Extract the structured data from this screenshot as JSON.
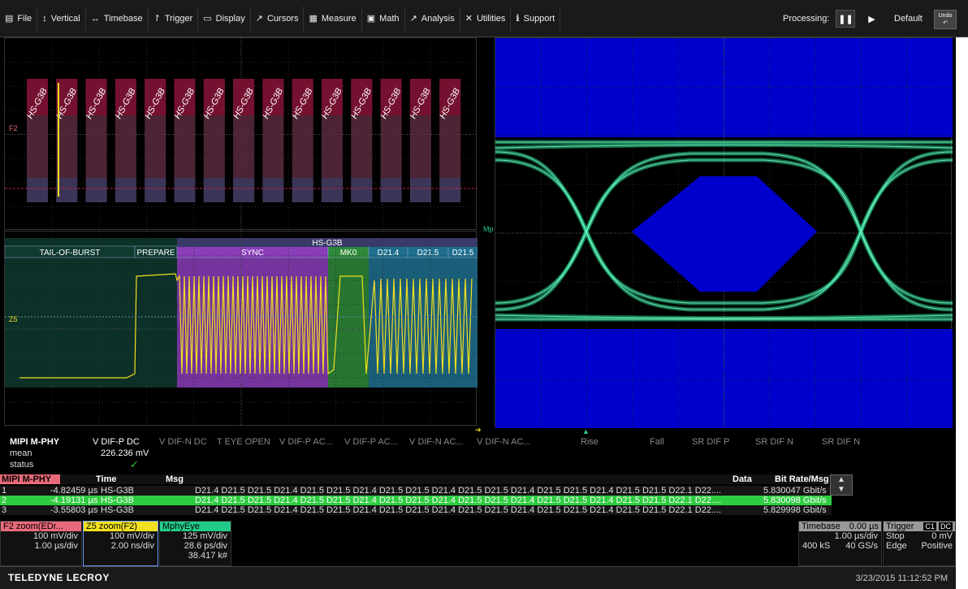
{
  "menu": [
    {
      "icon": "clipboard-icon",
      "glyph": "▤",
      "label": "File"
    },
    {
      "icon": "vertical-arrows-icon",
      "glyph": "↕",
      "label": "Vertical"
    },
    {
      "icon": "horizontal-arrows-icon",
      "glyph": "↔",
      "label": "Timebase"
    },
    {
      "icon": "trigger-flag-icon",
      "glyph": "↾",
      "label": "Trigger"
    },
    {
      "icon": "display-icon",
      "glyph": "▭",
      "label": "Display"
    },
    {
      "icon": "cursor-icon",
      "glyph": "↗",
      "label": "Cursors"
    },
    {
      "icon": "measure-icon",
      "glyph": "▦",
      "label": "Measure"
    },
    {
      "icon": "math-icon",
      "glyph": "▣",
      "label": "Math"
    },
    {
      "icon": "analysis-icon",
      "glyph": "↗",
      "label": "Analysis"
    },
    {
      "icon": "utilities-icon",
      "glyph": "✕",
      "label": "Utilities"
    },
    {
      "icon": "info-icon",
      "glyph": "ℹ",
      "label": "Support"
    }
  ],
  "processing_label": "Processing:",
  "default_label": "Default",
  "undo_label": "Undo",
  "top_panel": {
    "channel_marker": "F2",
    "packet_label": "HS-G3B",
    "packet_count": 15
  },
  "zoom_panel": {
    "channel_marker": "Z5",
    "header_label": "HS-G3B",
    "segments": [
      {
        "label": "TAIL-OF-BURST",
        "color": "#0f3a30"
      },
      {
        "label": "PREPARE",
        "color": "#0f3a30"
      },
      {
        "label": "SYNC",
        "color": "#8a3db8"
      },
      {
        "label": "MK0",
        "color": "#2e8a3a"
      },
      {
        "label": "D21.4",
        "color": "#1e6e8e"
      },
      {
        "label": "D21.5",
        "color": "#1e6e8e"
      },
      {
        "label": "D21.5",
        "color": "#1e6e8e"
      }
    ]
  },
  "eye_panel": {
    "marker": "Mp"
  },
  "measurements": {
    "title": "MIPI M-PHY",
    "row_labels": [
      "mean",
      "status"
    ],
    "active": {
      "name": "V DIF-P DC",
      "mean": "226.236 mV",
      "status": "✓"
    },
    "others": [
      "V DIF-N DC",
      "T EYE OPEN",
      "V DIF-P AC...",
      "V DIF-P AC...",
      "V DIF-N AC...",
      "V DIF-N AC...",
      "Rise",
      "Fall",
      "SR DIF P",
      "SR DIF N",
      "SR DIF N"
    ]
  },
  "table": {
    "headers": {
      "name": "MIPI M-PHY",
      "time": "Time",
      "msg": "Msg",
      "data": "Data",
      "bitrate": "Bit Rate/Msg"
    },
    "rows": [
      {
        "index": "1",
        "time": "-4.82459 µs",
        "msg": "HS-G3B",
        "data": "D21.4 D21.5 D21.5 D21.4 D21.5 D21.5 D21.4 D21.5 D21.5 D21.4 D21.5 D21.5 D21.4 D21.5 D21.5 D21.4 D21.5 D21.5 D22.1 D22....",
        "bitrate": "5.830047 Gbit/s",
        "selected": false
      },
      {
        "index": "2",
        "time": "-4.19131 µs",
        "msg": "HS-G3B",
        "data": "D21.4 D21.5 D21.5 D21.4 D21.5 D21.5 D21.4 D21.5 D21.5 D21.4 D21.5 D21.5 D21.4 D21.5 D21.5 D21.4 D21.5 D21.5 D22.1 D22....",
        "bitrate": "5.830098 Gbit/s",
        "selected": true
      },
      {
        "index": "3",
        "time": "-3.55803 µs",
        "msg": "HS-G3B",
        "data": "D21.4 D21.5 D21.5 D21.4 D21.5 D21.5 D21.4 D21.5 D21.5 D21.4 D21.5 D21.5 D21.4 D21.5 D21.5 D21.4 D21.5 D21.5 D22.1 D22....",
        "bitrate": "5.829998 Gbit/s",
        "selected": false
      }
    ]
  },
  "traces": {
    "f2": {
      "title": "F2 zoom(EDr...",
      "line1": "100 mV/div",
      "line2": "1.00 µs/div",
      "color": "#e86a7a"
    },
    "z5": {
      "title": "Z5 zoom(F2)",
      "line1": "100 mV/div",
      "line2": "2.00 ns/div",
      "color": "#f0e020"
    },
    "eye": {
      "title": "MphyEye",
      "line1": "125 mV/div",
      "line2": "28.6 ps/div",
      "line3": "38.417 k#",
      "color": "#22cc88"
    }
  },
  "timebase": {
    "title": "Timebase",
    "delay": "0.00 µs",
    "per_div": "1.00 µs/div",
    "samples": "400 kS",
    "rate": "40 GS/s"
  },
  "trigger": {
    "title": "Trigger",
    "badge1": "C1",
    "badge2": "DC",
    "mode": "Stop",
    "level": "0 mV",
    "type": "Edge",
    "slope": "Positive"
  },
  "footer": {
    "brand": "TELEDYNE LECROY",
    "datetime": "3/23/2015 11:12:52 PM"
  }
}
